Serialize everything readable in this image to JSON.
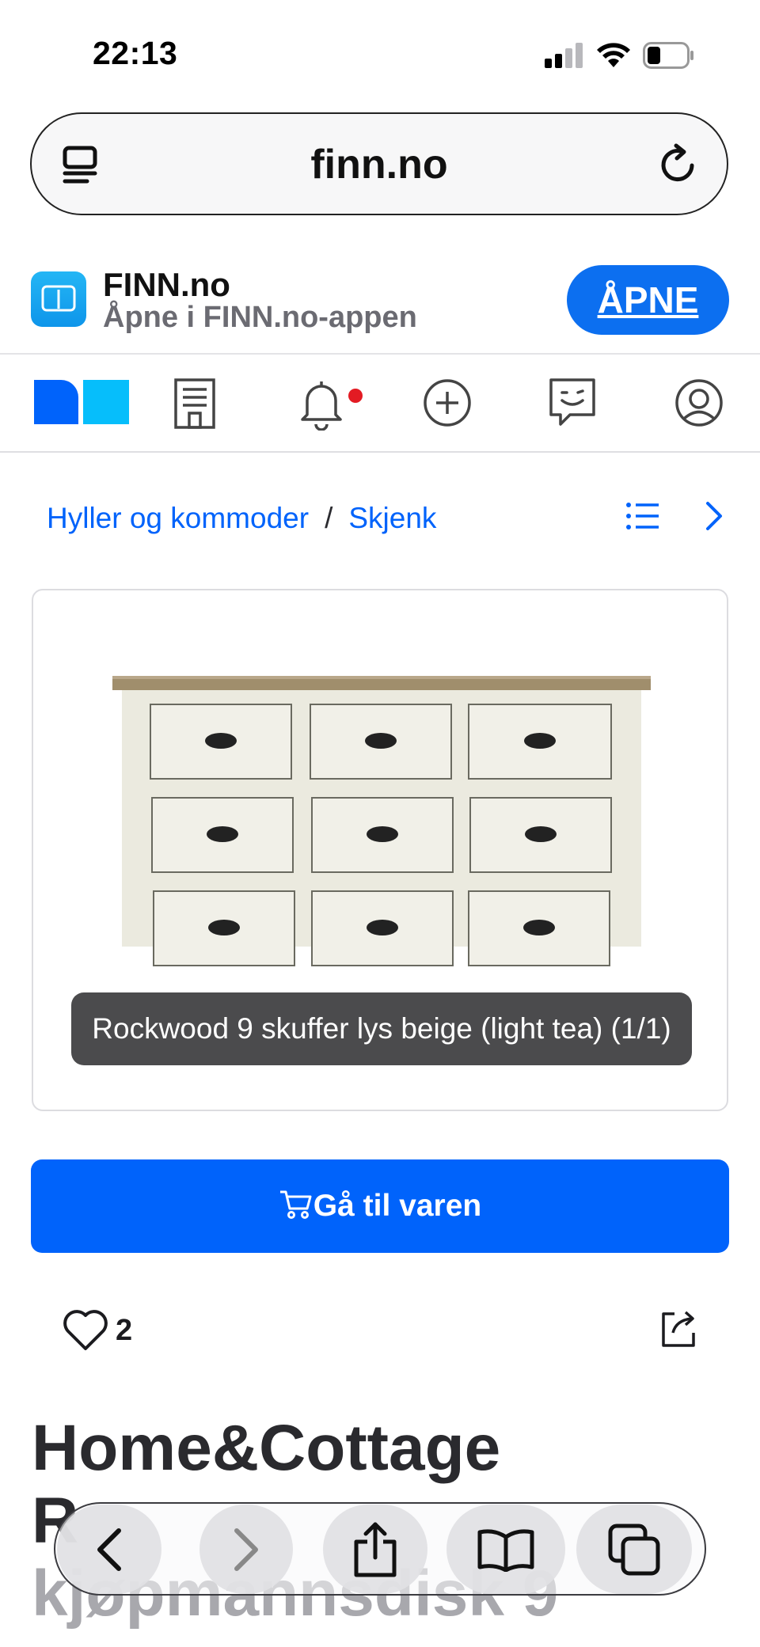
{
  "status_bar": {
    "time": "22:13",
    "icons": [
      "signal-icon",
      "wifi-icon",
      "battery-icon"
    ]
  },
  "browser": {
    "url": "finn.no",
    "icons": [
      "tabs-icon",
      "reload-icon"
    ]
  },
  "app_banner": {
    "app_name": "FINN.no",
    "subtitle": "Åpne i FINN.no-appen",
    "open_label": "ÅPNE",
    "accent": "#0c6ff0"
  },
  "nav": {
    "items": [
      "finn-logo",
      "building-icon",
      "bell-icon",
      "plus-circle-icon",
      "chat-icon",
      "profile-icon"
    ],
    "notification_color": "#e31b23"
  },
  "breadcrumb": {
    "item1": "Hyller og kommoder",
    "separator": "/",
    "item2": "Skjenk"
  },
  "image": {
    "caption": "Rockwood 9 skuffer lys beige (light tea) (1/1)"
  },
  "cta": {
    "label": "Gå til varen",
    "color": "#0063fb"
  },
  "favorites": {
    "count": "2"
  },
  "listing": {
    "title_line1": "Home&Cottage",
    "title_line2": "R",
    "title_line3": "kjøpmannsdisk 9"
  },
  "toolbar": {
    "icons": [
      "back-icon",
      "forward-icon",
      "share-icon",
      "bookmarks-icon",
      "tabs-overview-icon"
    ]
  }
}
